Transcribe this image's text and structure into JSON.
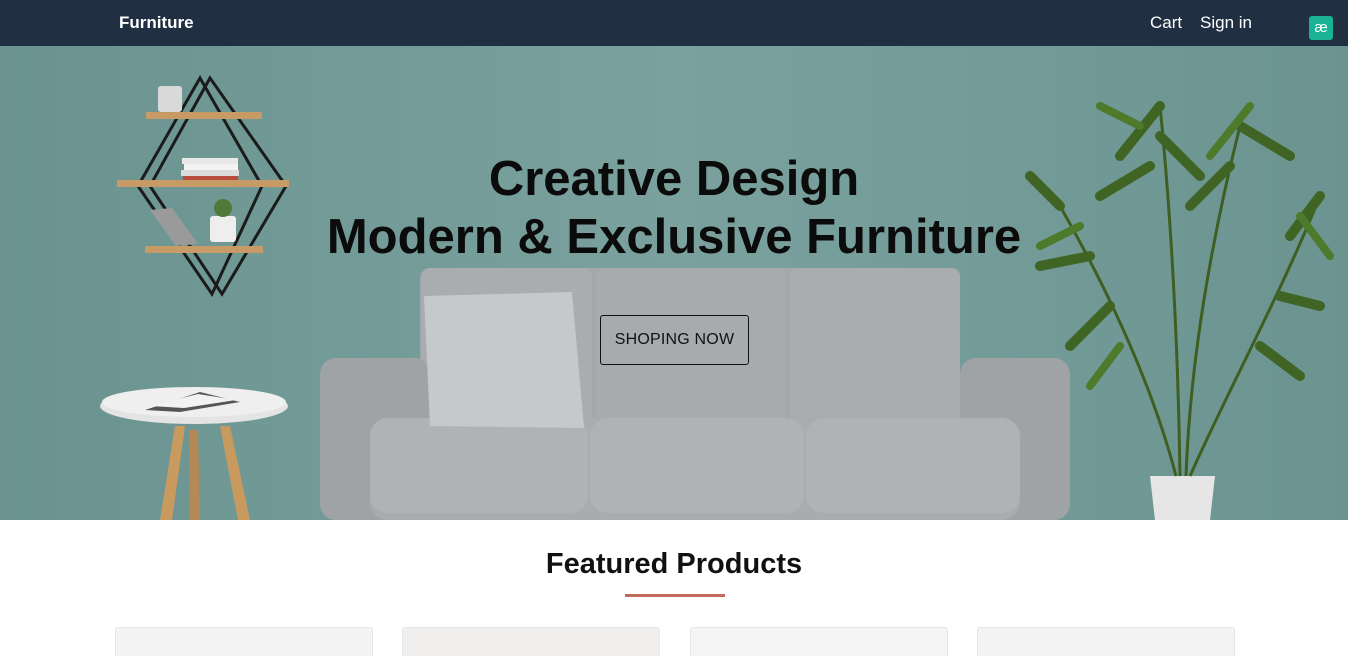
{
  "navbar": {
    "brand": "Furniture",
    "links": {
      "cart": "Cart",
      "signin": "Sign in"
    },
    "extension_badge": "æ",
    "background": "#212f43"
  },
  "hero": {
    "title_line1": "Creative Design",
    "title_line2": "Modern & Exclusive Furniture",
    "button_label": "SHOPING NOW",
    "wall_color": "#6f9693"
  },
  "featured": {
    "title": "Featured Products",
    "accent_color": "#c26a5c",
    "products": [
      {
        "icon": "product-image"
      },
      {
        "icon": "product-image"
      },
      {
        "icon": "product-image"
      },
      {
        "icon": "product-image"
      }
    ]
  }
}
